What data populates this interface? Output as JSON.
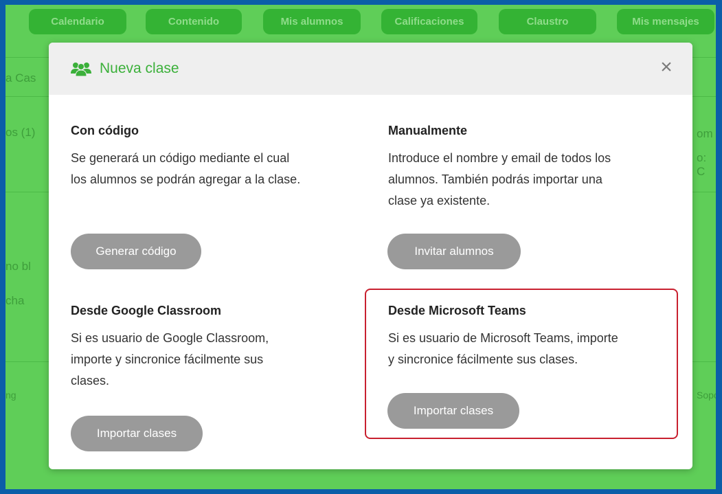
{
  "nav": {
    "items": [
      "Calendario",
      "Contenido",
      "Mis alumnos",
      "Calificaciones",
      "Claustro",
      "Mis mensajes"
    ]
  },
  "background_fragments": [
    "a Cas",
    "os (1)",
    "no bl",
    "cha",
    "ng",
    "om",
    "o: C",
    "Sopo"
  ],
  "modal": {
    "title": "Nueva clase",
    "close_symbol": "×",
    "icon": "users-icon",
    "options": [
      {
        "title": "Con código",
        "description": [
          "Se generará un código mediante el cual",
          "los alumnos se podrán agregar a la clase."
        ],
        "button": "Generar código"
      },
      {
        "title": "Manualmente",
        "description": [
          "Introduce el nombre y email de todos los",
          "alumnos. También podrás importar una",
          "clase ya existente."
        ],
        "button": "Invitar alumnos"
      },
      {
        "title": "Desde Google Classroom",
        "description": [
          "Si es usuario de Google Classroom,",
          "importe y sincronice fácilmente sus",
          "clases."
        ],
        "button": "Importar clases"
      },
      {
        "title": "Desde Microsoft Teams",
        "description": [
          "Si es usuario de Microsoft Teams, importe",
          "y sincronice fácilmente sus clases."
        ],
        "button": "Importar clases"
      }
    ]
  },
  "colors": {
    "outer_border": "#0b5ea8",
    "page_green": "#5fce58",
    "title_green": "#3bb03a",
    "button_gray": "#9a9a9a",
    "highlight_red": "#c8202f"
  }
}
